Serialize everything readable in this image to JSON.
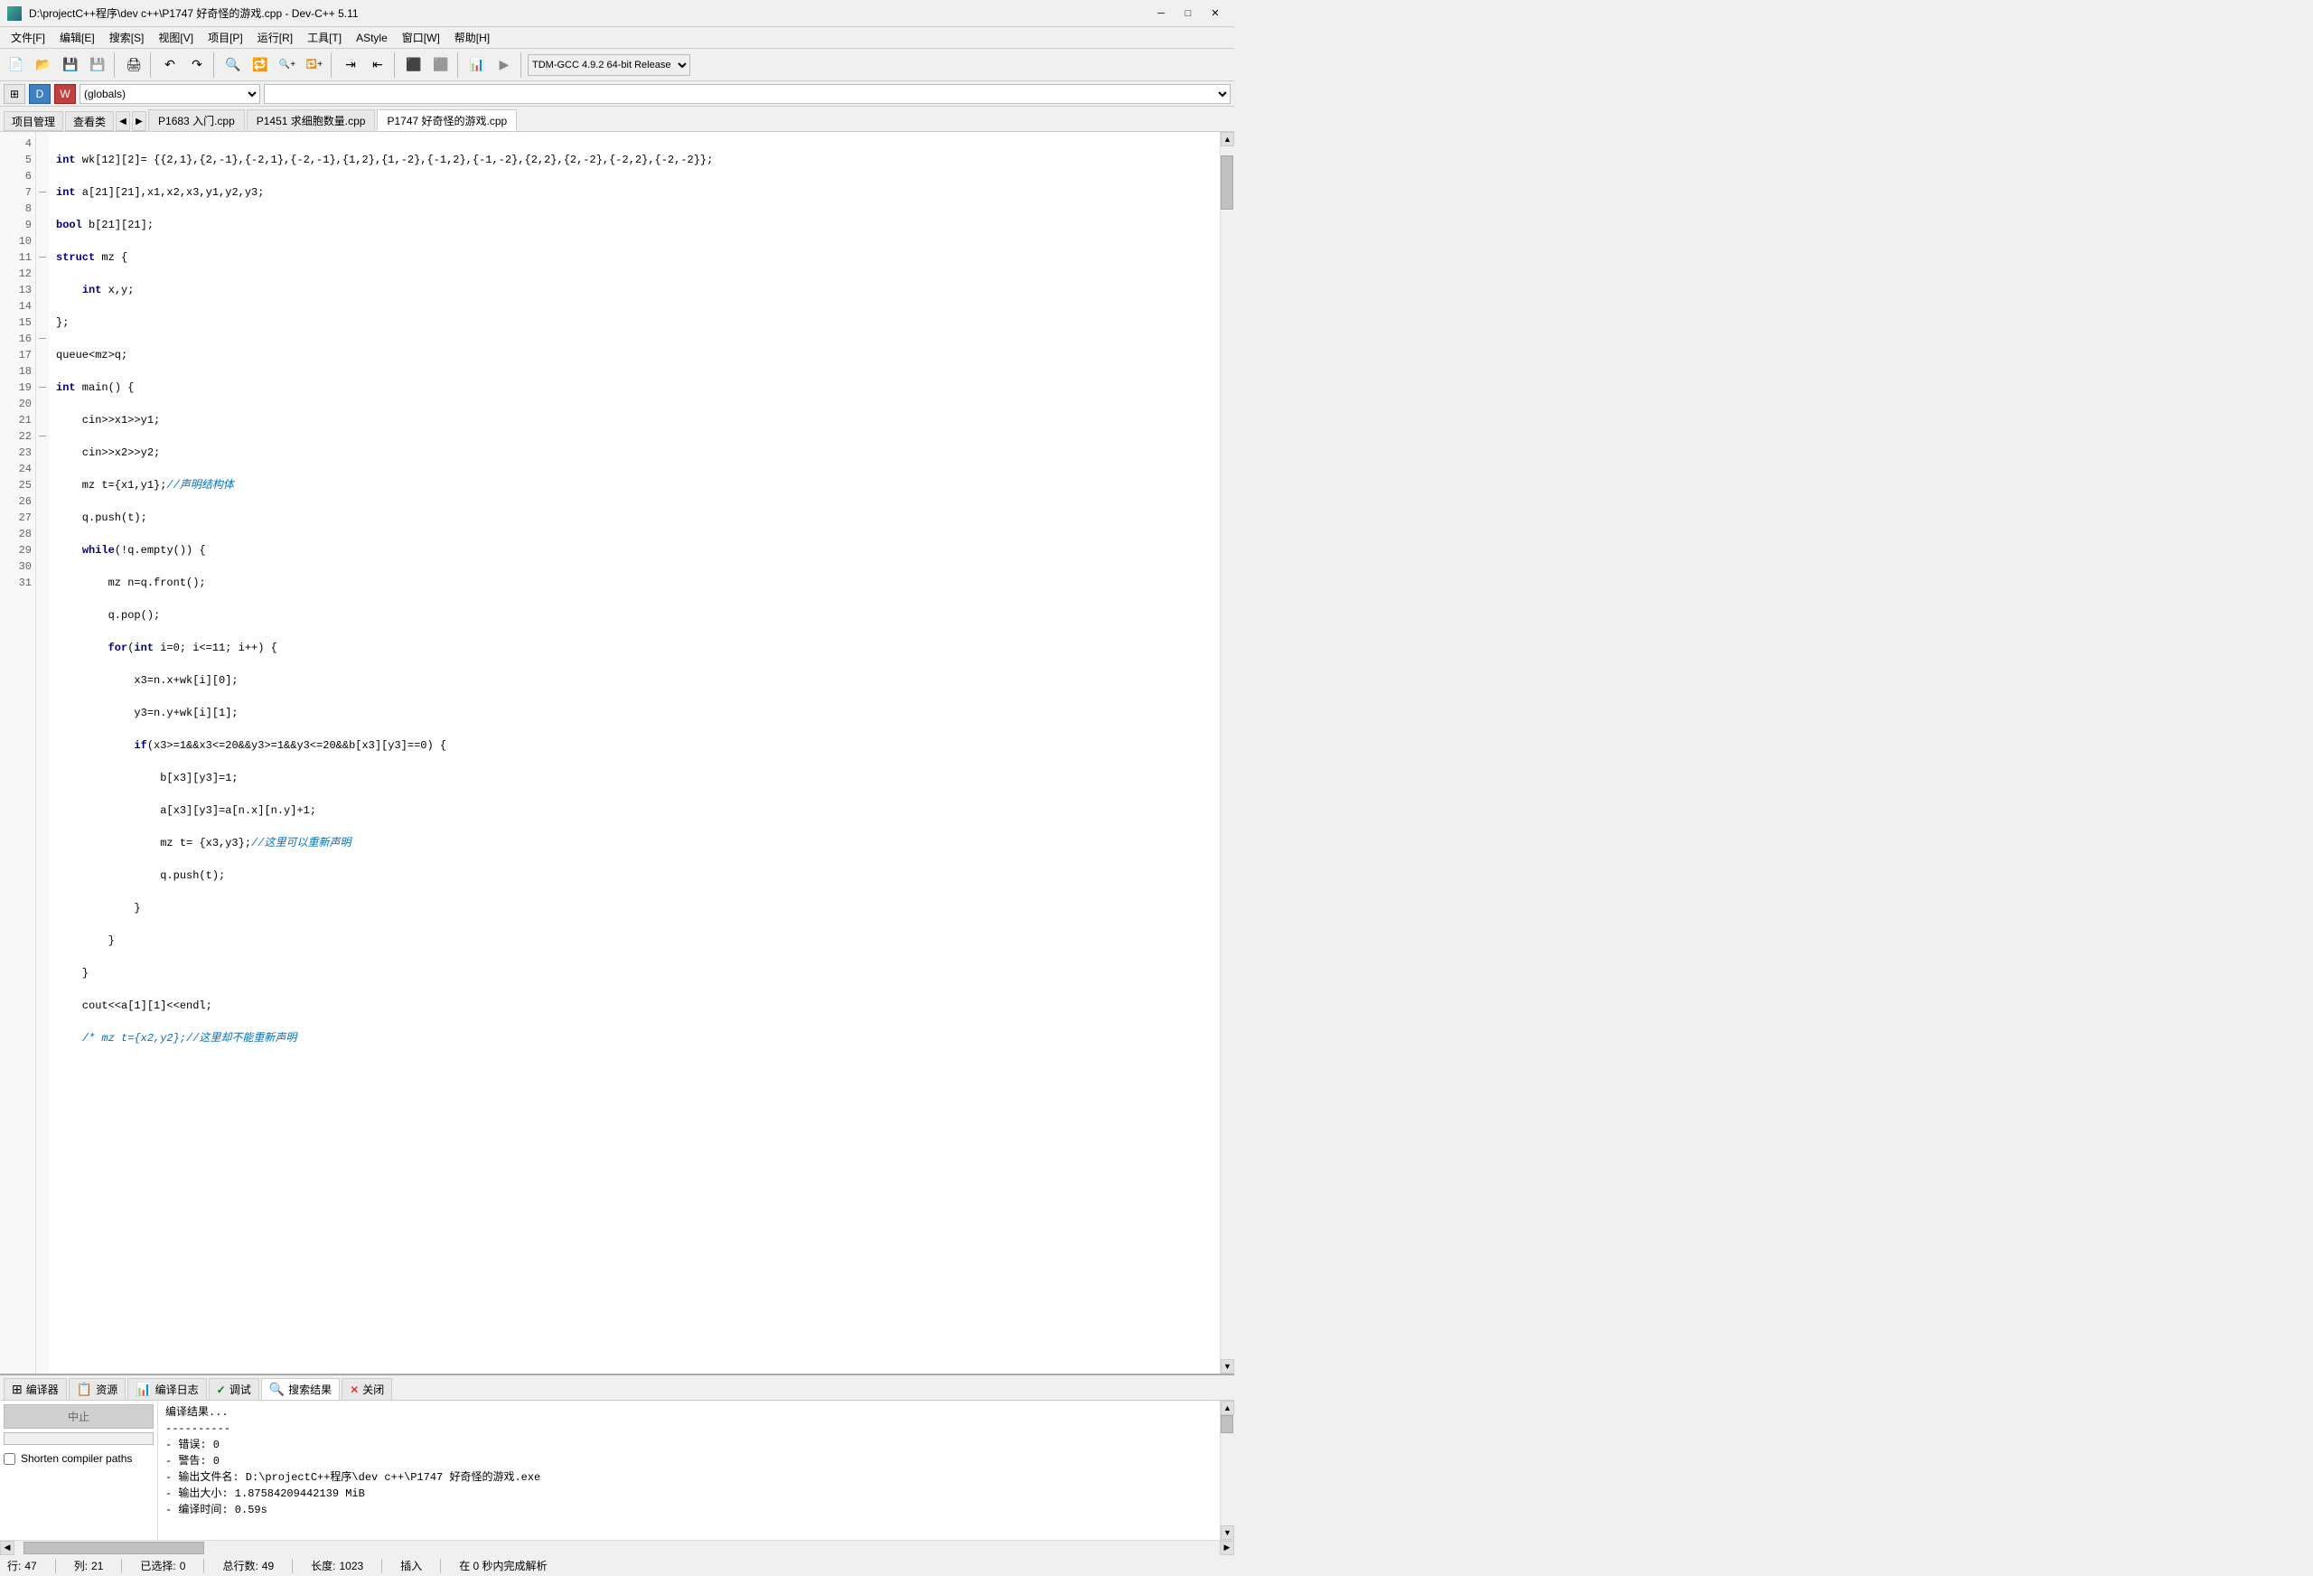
{
  "titlebar": {
    "title": "D:\\projectC++程序\\dev c++\\P1747 好奇怪的游戏.cpp - Dev-C++ 5.11",
    "minimize": "─",
    "maximize": "□",
    "close": "✕"
  },
  "menubar": {
    "items": [
      "文件[F]",
      "编辑[E]",
      "搜索[S]",
      "视图[V]",
      "项目[P]",
      "运行[R]",
      "工具[T]",
      "AStyle",
      "窗口[W]",
      "帮助[H]"
    ]
  },
  "toolbar2": {
    "scope_value": "(globals)",
    "func_value": ""
  },
  "tabbar": {
    "project_mgr": "项目管理",
    "view_class": "查看类",
    "tabs": [
      {
        "label": "P1683 入门.cpp",
        "active": false
      },
      {
        "label": "P1451 求细胞数量.cpp",
        "active": false
      },
      {
        "label": "P1747 好奇怪的游戏.cpp",
        "active": true
      }
    ]
  },
  "code": {
    "compiler_select": "TDM-GCC 4.9.2 64-bit Release",
    "lines": [
      {
        "num": 4,
        "fold": "",
        "content": "    <kw>int</kw> wk[12][2]= {{2,1},{2,-1},{-2,1},{-2,-1},{1,2},{1,-2},{-1,2},{-1,-2},{2,2},{2,-2},{-2,2},{-2,-2}};"
      },
      {
        "num": 5,
        "fold": "",
        "content": "    <kw>int</kw> a[21][21],x1,x2,x3,y1,y2,y3;"
      },
      {
        "num": 6,
        "fold": "",
        "content": "    <kw>bool</kw> b[21][21];"
      },
      {
        "num": 7,
        "fold": "-",
        "content": "    <kw>struct</kw> mz {"
      },
      {
        "num": 8,
        "fold": "",
        "content": "        <kw>int</kw> x,y;"
      },
      {
        "num": 9,
        "fold": "",
        "content": "    };"
      },
      {
        "num": 10,
        "fold": "",
        "content": "    queue&lt;mz&gt;q;"
      },
      {
        "num": 11,
        "fold": "-",
        "content": "    <kw>int</kw> main() {"
      },
      {
        "num": 12,
        "fold": "",
        "content": "        cin&gt;&gt;x1&gt;&gt;y1;"
      },
      {
        "num": 13,
        "fold": "",
        "content": "        cin&gt;&gt;x2&gt;&gt;y2;"
      },
      {
        "num": 14,
        "fold": "",
        "content": "        mz t={x1,y1};<comment>//声明结构体</comment>"
      },
      {
        "num": 15,
        "fold": "",
        "content": "        q.push(t);"
      },
      {
        "num": 16,
        "fold": "-",
        "content": "        <kw>while</kw>(!q.empty()) {"
      },
      {
        "num": 17,
        "fold": "",
        "content": "            mz n=q.front();"
      },
      {
        "num": 18,
        "fold": "",
        "content": "            q.pop();"
      },
      {
        "num": 19,
        "fold": "-",
        "content": "            <kw>for</kw>(<kw>int</kw> i=0; i&lt;=11; i++) {"
      },
      {
        "num": 20,
        "fold": "",
        "content": "                x3=n.x+wk[i][0];"
      },
      {
        "num": 21,
        "fold": "",
        "content": "                y3=n.y+wk[i][1];"
      },
      {
        "num": 22,
        "fold": "-",
        "content": "                <kw>if</kw>(x3&gt;=1&amp;&amp;x3&lt;=20&amp;&amp;y3&gt;=1&amp;&amp;y3&lt;=20&amp;&amp;b[x3][y3]==0) {"
      },
      {
        "num": 23,
        "fold": "",
        "content": "                    b[x3][y3]=1;"
      },
      {
        "num": 24,
        "fold": "",
        "content": "                    a[x3][y3]=a[n.x][n.y]+1;"
      },
      {
        "num": 25,
        "fold": "",
        "content": "                    mz t= {x3,y3};<comment>//这里可以重新声明</comment>"
      },
      {
        "num": 26,
        "fold": "",
        "content": "                    q.push(t);"
      },
      {
        "num": 27,
        "fold": "",
        "content": "                }"
      },
      {
        "num": 28,
        "fold": "",
        "content": "            }"
      },
      {
        "num": 29,
        "fold": "",
        "content": "        }"
      },
      {
        "num": 30,
        "fold": "",
        "content": "        cout&lt;&lt;a[1][1]&lt;&lt;endl;"
      },
      {
        "num": 31,
        "fold": "",
        "content": "        <comment>/* mz t={x2,y2};//这里却不能重新声明</comment>"
      }
    ]
  },
  "bottom_panel": {
    "tabs": [
      {
        "icon": "⊞",
        "label": "编译器",
        "active": false
      },
      {
        "icon": "📋",
        "label": "资源",
        "active": false
      },
      {
        "icon": "📊",
        "label": "编译日志",
        "active": false
      },
      {
        "icon": "✓",
        "label": "调试",
        "active": false
      },
      {
        "icon": "🔍",
        "label": "搜索结果",
        "active": false
      },
      {
        "icon": "✕",
        "label": "关闭",
        "active": false
      }
    ],
    "stop_btn": "中止",
    "shorten_label": "Shorten compiler paths",
    "output": [
      "编译结果...",
      "----------",
      "- 错误: 0",
      "- 警告: 0",
      "- 输出文件名: D:\\projectC++程序\\dev c++\\P1747 好奇怪的游戏.exe",
      "- 输出大小: 1.87584209442139 MiB",
      "- 编译时间: 0.59s"
    ]
  },
  "statusbar": {
    "row_label": "行: ",
    "row_val": "47",
    "col_label": "列: ",
    "col_val": "21",
    "selected_label": "已选择: ",
    "selected_val": "0",
    "total_label": "总行数: ",
    "total_val": "49",
    "len_label": "长度: ",
    "len_val": "1023",
    "mode": "插入",
    "parse_info": "在 0 秒内完成解析"
  }
}
